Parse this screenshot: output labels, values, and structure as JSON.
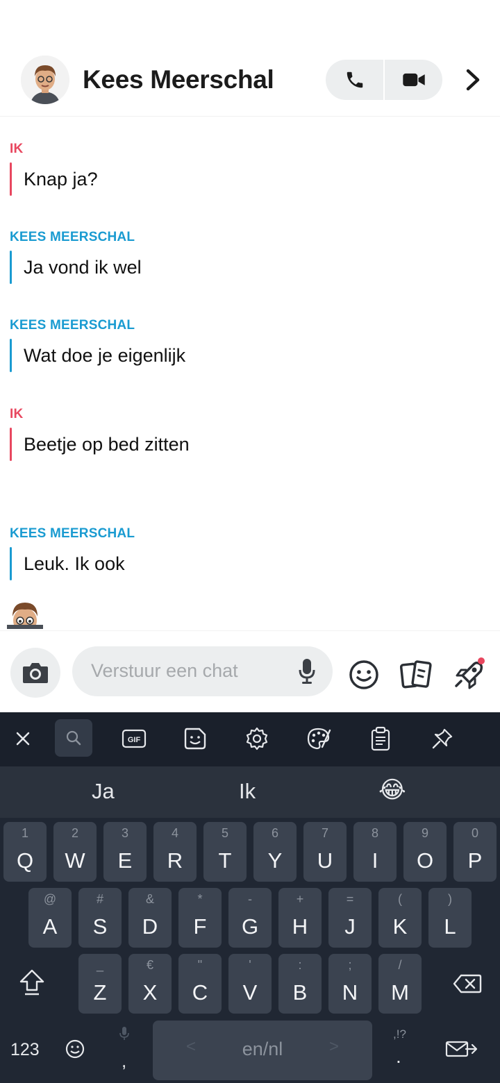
{
  "header": {
    "contact_name": "Kees Meerschal",
    "avatar": "bitmoji-avatar",
    "call_icon": "phone-icon",
    "video_icon": "video-camera-icon",
    "more_icon": "chevron-right-icon"
  },
  "messages": [
    {
      "sender": "IK",
      "text": "Knap ja?",
      "from_me": true
    },
    {
      "sender": "KEES MEERSCHAL",
      "text": "Ja vond ik wel",
      "from_me": false
    },
    {
      "sender": "KEES MEERSCHAL",
      "text": "Wat doe je eigenlijk",
      "from_me": false
    },
    {
      "sender": "IK",
      "text": "Beetje op bed zitten",
      "from_me": true
    },
    {
      "sender": "KEES MEERSCHAL",
      "text": "Leuk. Ik ook",
      "from_me": false
    }
  ],
  "composer": {
    "placeholder": "Verstuur een chat",
    "icons": [
      "camera-icon",
      "microphone-icon",
      "smiley-icon",
      "sticker-cards-icon",
      "rocket-icon"
    ]
  },
  "keyboard": {
    "toolbar": [
      "close-icon",
      "search-icon",
      "gif-icon",
      "sticker-icon",
      "settings-icon",
      "palette-icon",
      "clipboard-icon",
      "pin-icon"
    ],
    "gif_label": "GIF",
    "suggestions": [
      "Ja",
      "Ik",
      "😂"
    ],
    "rows": [
      [
        {
          "k": "Q",
          "h": "1"
        },
        {
          "k": "W",
          "h": "2"
        },
        {
          "k": "E",
          "h": "3"
        },
        {
          "k": "R",
          "h": "4"
        },
        {
          "k": "T",
          "h": "5"
        },
        {
          "k": "Y",
          "h": "6"
        },
        {
          "k": "U",
          "h": "7"
        },
        {
          "k": "I",
          "h": "8"
        },
        {
          "k": "O",
          "h": "9"
        },
        {
          "k": "P",
          "h": "0"
        }
      ],
      [
        {
          "k": "A",
          "h": "@"
        },
        {
          "k": "S",
          "h": "#"
        },
        {
          "k": "D",
          "h": "&"
        },
        {
          "k": "F",
          "h": "*"
        },
        {
          "k": "G",
          "h": "-"
        },
        {
          "k": "H",
          "h": "+"
        },
        {
          "k": "J",
          "h": "="
        },
        {
          "k": "K",
          "h": "("
        },
        {
          "k": "L",
          "h": ")"
        }
      ],
      [
        {
          "k": "Z",
          "h": "_"
        },
        {
          "k": "X",
          "h": "€"
        },
        {
          "k": "C",
          "h": "\""
        },
        {
          "k": "V",
          "h": "'"
        },
        {
          "k": "B",
          "h": ":"
        },
        {
          "k": "N",
          "h": ";"
        },
        {
          "k": "M",
          "h": "/"
        }
      ]
    ],
    "num_label": "123",
    "space_label": "en/nl",
    "comma": ",",
    "period": ".",
    "punct_hint": ",!?",
    "shift_icon": "shift-icon",
    "backspace_icon": "backspace-icon",
    "enter_icon": "send-mail-icon",
    "emoji_icon": "emoji-icon",
    "mic_hint_icon": "microphone-icon"
  },
  "colors": {
    "me": "#e8475f",
    "them": "#1a9bd1",
    "keyboard_bg": "#202733",
    "key_bg": "#3b4350"
  }
}
